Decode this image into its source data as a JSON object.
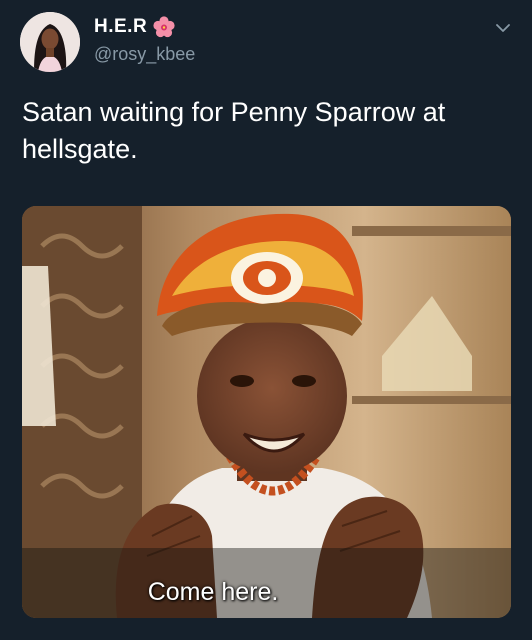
{
  "tweet": {
    "display_name": "H.E.R",
    "name_emoji": "hibiscus-icon",
    "handle": "@rosy_kbee",
    "text": "Satan waiting for Penny Sparrow at hellsgate.",
    "menu_icon": "chevron-down-icon",
    "media": {
      "subtitle": "Come here."
    }
  },
  "colors": {
    "background": "#15202b",
    "primary_text": "#ffffff",
    "secondary_text": "#8899a6"
  }
}
